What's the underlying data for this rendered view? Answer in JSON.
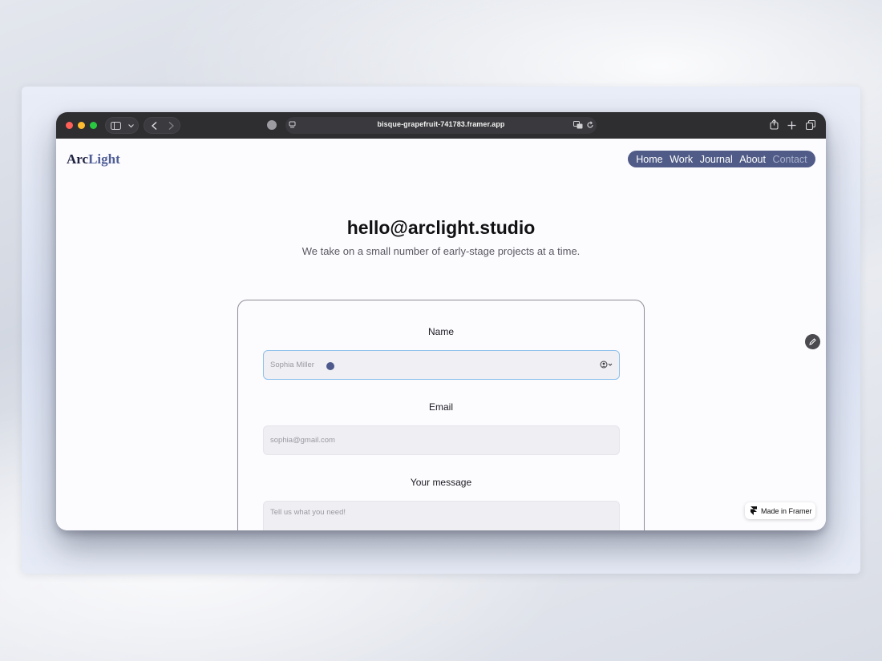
{
  "browser": {
    "url": "bisque-grapefruit-741783.framer.app",
    "icons": [
      "sidebar-icon",
      "chevron-down-icon",
      "back-icon",
      "forward-icon",
      "extension-icon",
      "page-settings-icon",
      "translate-icon",
      "reload-icon",
      "share-icon",
      "new-tab-icon",
      "tabs-overview-icon"
    ]
  },
  "site": {
    "logo": {
      "part1": "Arc",
      "part2": "Light"
    },
    "nav": {
      "items": [
        {
          "label": "Home"
        },
        {
          "label": "Work"
        },
        {
          "label": "Journal"
        },
        {
          "label": "About"
        },
        {
          "label": "Contact"
        }
      ],
      "active": "Contact"
    },
    "hero": {
      "title": "hello@arclight.studio",
      "subtitle": "We take on a small number of early-stage projects at a time."
    },
    "form": {
      "name_label": "Name",
      "name_placeholder": "Sophia Miller",
      "email_label": "Email",
      "email_placeholder": "sophia@gmail.com",
      "message_label": "Your message",
      "message_placeholder": "Tell us what you need!"
    },
    "badge": {
      "label": "Made in Framer"
    }
  },
  "colors": {
    "nav_bg": "#505c87",
    "focus_border": "#8fc1ec",
    "titlebar": "#2e2d30"
  }
}
